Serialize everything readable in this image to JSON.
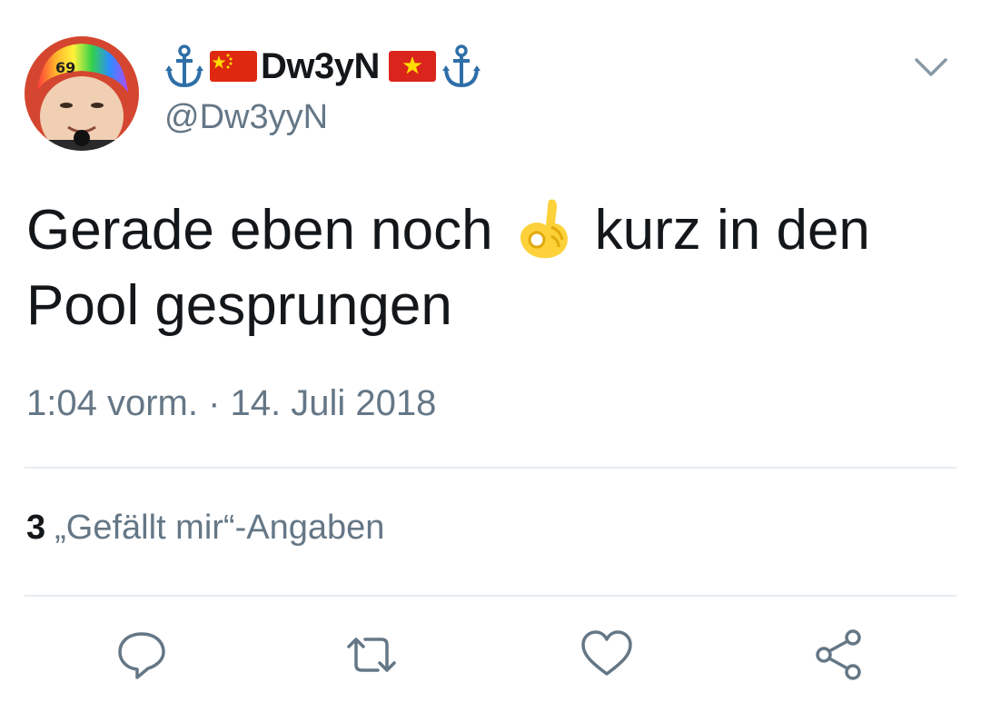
{
  "user": {
    "display_name": "Dw3yN",
    "handle": "@Dw3yyN",
    "avatar_text": "69"
  },
  "tweet": {
    "text_part1": "Gerade eben noch",
    "emoji": "ok-hand",
    "text_part2": "kurz in den Pool gesprungen",
    "time": "1:04 vorm.",
    "separator": "·",
    "date": "14. Juli 2018"
  },
  "stats": {
    "likes_count": "3",
    "likes_label": "„Gefällt mir“-Angaben"
  },
  "actions": [
    "reply-icon",
    "retweet-icon",
    "like-icon",
    "share-icon"
  ],
  "colors": {
    "primary_text": "#14171a",
    "secondary_text": "#657786",
    "divider": "#e6ecf0",
    "icon_accent": "#1da1f2",
    "flag_red": "#de2910",
    "flag_yellow": "#ffde00"
  }
}
